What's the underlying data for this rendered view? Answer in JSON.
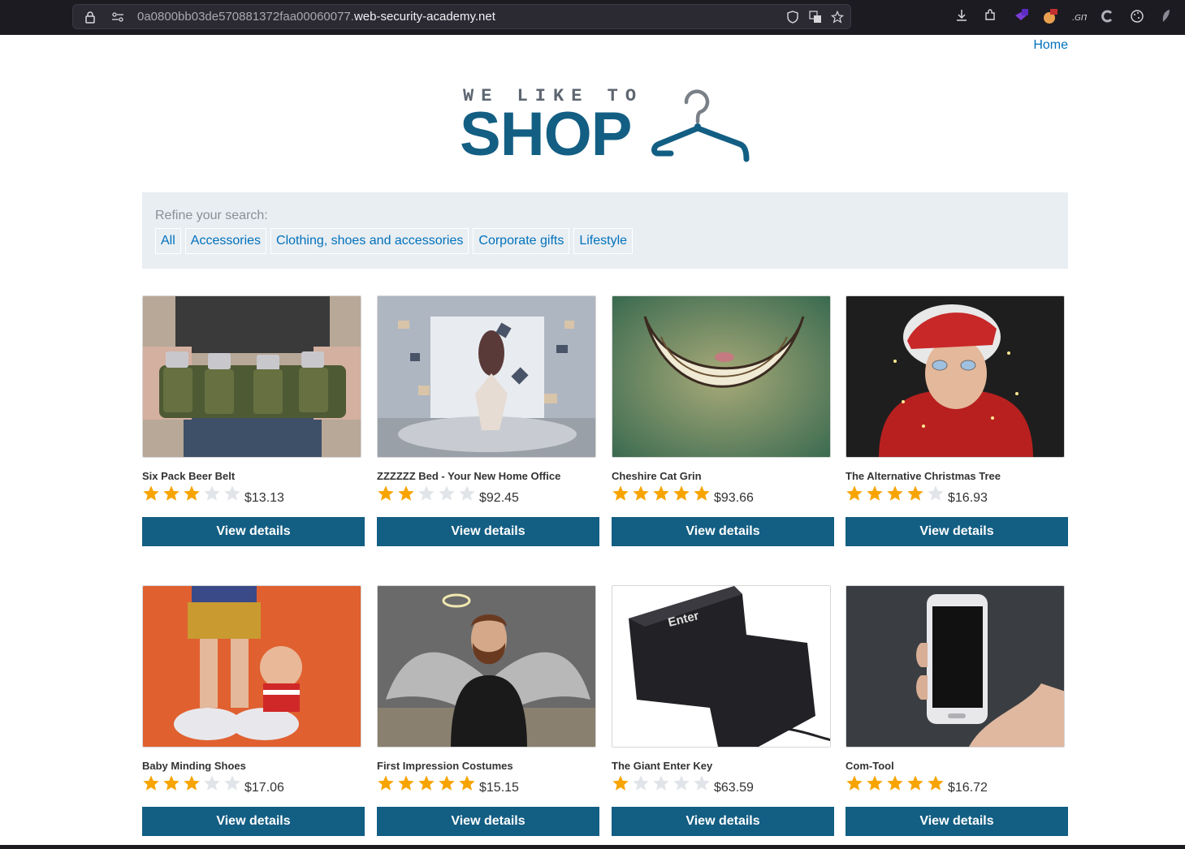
{
  "browser": {
    "url_prefix": "0a0800bb03de570881372faa00060077.",
    "url_host": "web-security-academy.net"
  },
  "nav": {
    "home_label": "Home"
  },
  "logo": {
    "top_text": "WE LIKE TO",
    "main_text": "SHOP"
  },
  "filter": {
    "label": "Refine your search:",
    "tags": [
      "All",
      "Accessories",
      "Clothing, shoes and accessories",
      "Corporate gifts",
      "Lifestyle"
    ]
  },
  "products": [
    {
      "name": "Six Pack Beer Belt",
      "rating": 3,
      "price": "$13.13",
      "button": "View details",
      "image": "beer-belt-photo"
    },
    {
      "name": "ZZZZZZ Bed - Your New Home Office",
      "rating": 2,
      "price": "$92.45",
      "button": "View details",
      "image": "bed-office-photo"
    },
    {
      "name": "Cheshire Cat Grin",
      "rating": 5,
      "price": "$93.66",
      "button": "View details",
      "image": "cat-grin-photo"
    },
    {
      "name": "The Alternative Christmas Tree",
      "rating": 4,
      "price": "$16.93",
      "button": "View details",
      "image": "christmas-tree-photo"
    },
    {
      "name": "Baby Minding Shoes",
      "rating": 3,
      "price": "$17.06",
      "button": "View details",
      "image": "baby-shoes-photo"
    },
    {
      "name": "First Impression Costumes",
      "rating": 5,
      "price": "$15.15",
      "button": "View details",
      "image": "angel-costume-photo"
    },
    {
      "name": "The Giant Enter Key",
      "rating": 1,
      "price": "$63.59",
      "button": "View details",
      "image": "enter-key-photo"
    },
    {
      "name": "Com-Tool",
      "rating": 5,
      "price": "$16.72",
      "button": "View details",
      "image": "phone-photo"
    }
  ],
  "colors": {
    "brand": "#135e83",
    "link": "#0071bc",
    "star_on": "#f7a400",
    "star_off": "#e1e4e8",
    "panel": "#e9eef2"
  }
}
